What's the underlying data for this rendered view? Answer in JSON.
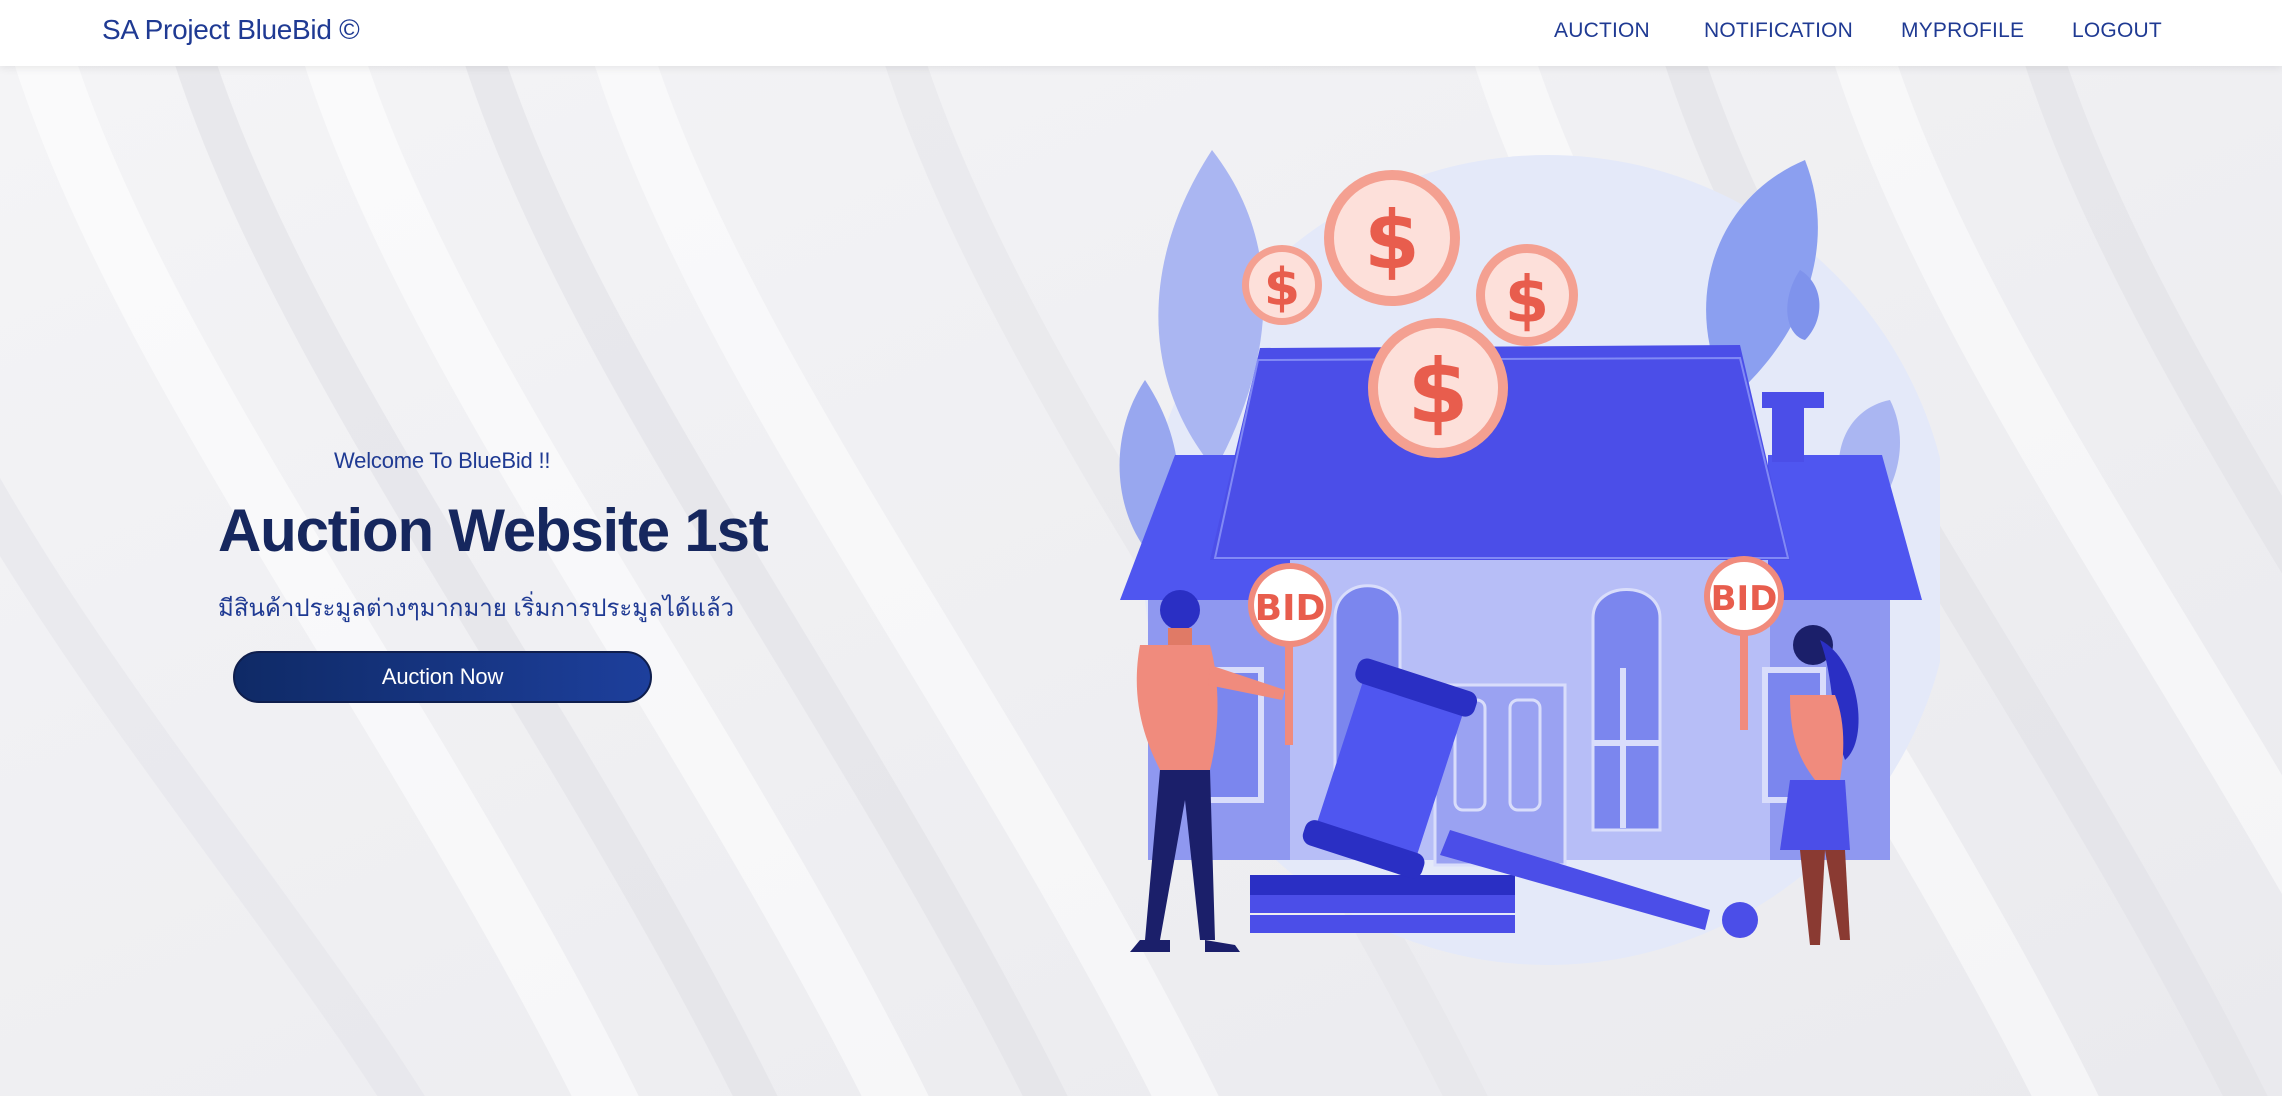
{
  "navbar": {
    "brand": "SA Project BlueBid ©",
    "links": [
      {
        "label": "AUCTION"
      },
      {
        "label": "NOTIFICATION"
      },
      {
        "label": "MYPROFILE"
      },
      {
        "label": "LOGOUT"
      }
    ]
  },
  "hero": {
    "welcome": "Welcome To BlueBid !!",
    "title": "Auction Website 1st",
    "subtitle": "มีสินค้าประมูลต่างๆมากมาย เริ่มการประมูลได้แล้ว",
    "cta_label": "Auction Now"
  },
  "illustration": {
    "coin_symbol": "$",
    "sign_text": "BID"
  },
  "colors": {
    "brand": "#1f3a93",
    "title": "#16275e",
    "accent_blue": "#4f56f0",
    "coin": "#f08b7d"
  }
}
